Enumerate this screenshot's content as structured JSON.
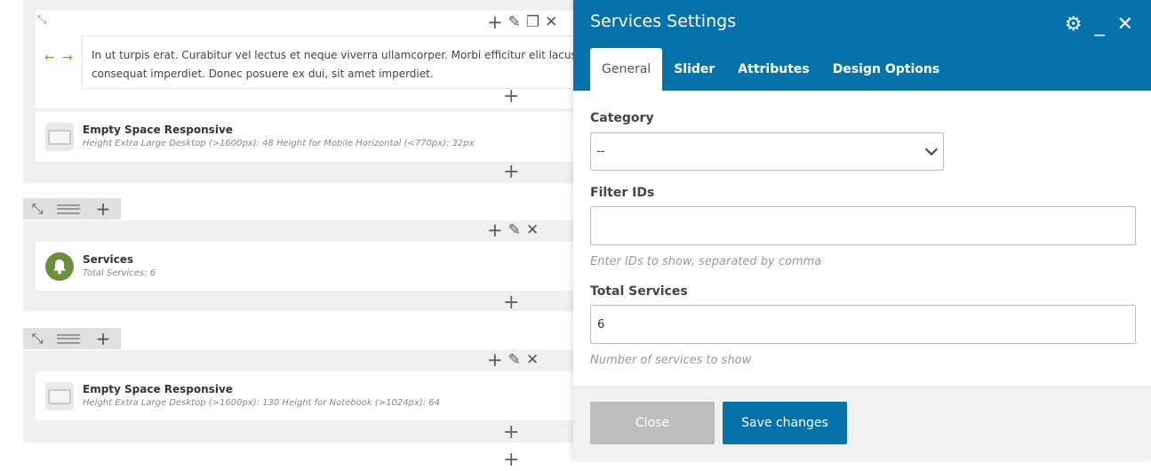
{
  "canvas": {
    "text_block": "In ut turpis erat. Curabitur vel lectus et neque viverra ullamcorper. Morbi efficitur elit lacus, in consequat imperdiet. Donec posuere ex dui, sit amet imperdiet.",
    "arrows": "← →",
    "element1": {
      "title": "Empty Space Responsive",
      "sub": "Height Extra Large Desktop (>1600px): 48  Height for Mobile Horizontal (<770px): 32px"
    },
    "element2": {
      "title": "Services",
      "sub": "Total Services: 6"
    },
    "element3": {
      "title": "Empty Space Responsive",
      "sub": "Height Extra Large Desktop (>1600px): 130  Height for Notebook (>1024px): 64"
    },
    "plus": "+",
    "pencil": "✎",
    "copy": "❐",
    "times": "✕",
    "expand": "⤡"
  },
  "panel": {
    "title": "Services Settings",
    "icons": {
      "gear": "⚙",
      "minimize": "_",
      "close": "✕"
    },
    "tabs": [
      {
        "label": "General",
        "active": true
      },
      {
        "label": "Slider"
      },
      {
        "label": "Attributes"
      },
      {
        "label": "Design Options"
      }
    ],
    "fields": {
      "category_label": "Category",
      "category_value": "--",
      "filter_label": "Filter IDs",
      "filter_value": "",
      "filter_help": "Enter IDs to show, separated by comma",
      "total_label": "Total Services",
      "total_value": "6",
      "total_help": "Number of services to show"
    },
    "buttons": {
      "close": "Close",
      "save": "Save changes"
    }
  },
  "colors": {
    "accent": "#0672aa",
    "green_icon": "#6c8f3f",
    "disabled": "#bdbdbd"
  }
}
